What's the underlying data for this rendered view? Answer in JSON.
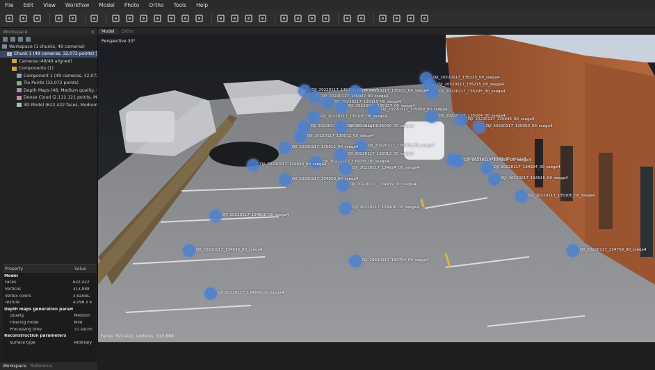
{
  "menu": [
    "File",
    "Edit",
    "View",
    "Workflow",
    "Model",
    "Photo",
    "Ortho",
    "Tools",
    "Help"
  ],
  "toolbar_icons": [
    "new-icon",
    "open-icon",
    "save-icon",
    "undo-icon",
    "redo-icon",
    "delete-icon",
    "select-icon",
    "rectangle-selection-icon",
    "resize-region-icon",
    "rotate-region-icon",
    "ruler-icon",
    "cut-icon",
    "crop-icon",
    "zoom-in-icon",
    "zoom-out-icon",
    "move-object-icon",
    "navigation-icon",
    "point-cloud-icon",
    "dense-cloud-icon",
    "model-icon",
    "tiled-model-icon",
    "shaded-icon",
    "textured-icon",
    "cameras-icon",
    "markers-icon",
    "images-icon",
    "reset-view-icon"
  ],
  "workspace": {
    "title": "Workspace",
    "tree": [
      {
        "label": "Workspace (1 chunks, 49 cameras)",
        "level": 0,
        "icon": "workspace-icon"
      },
      {
        "label": "Chunk 1 (49 cameras, 32,072 points) [T]",
        "level": 1,
        "icon": "chunk-icon",
        "selected": true
      },
      {
        "label": "Cameras (48/49 aligned)",
        "level": 2,
        "icon": "folder-icon"
      },
      {
        "label": "Components (1)",
        "level": 2,
        "icon": "folder-icon"
      },
      {
        "label": "Component 1 (49 cameras, 32,072 points",
        "level": 3,
        "icon": "component-icon"
      },
      {
        "label": "Tie Points (32,072 points)",
        "level": 3,
        "icon": "tie-points-icon"
      },
      {
        "label": "Depth Maps (48, Medium quality, Mild",
        "level": 3,
        "icon": "depth-maps-icon"
      },
      {
        "label": "Dense Cloud (2,112,121 points, Medium",
        "level": 3,
        "icon": "dense-cloud-icon"
      },
      {
        "label": "3D Model (622,422 faces, Medium qual",
        "level": 3,
        "icon": "model-icon"
      }
    ]
  },
  "properties": {
    "col_property": "Property",
    "col_value": "Value",
    "rows": [
      {
        "name": "Model",
        "value": "",
        "type": "section"
      },
      {
        "name": "Faces",
        "value": "622,422",
        "type": "row"
      },
      {
        "name": "Vertices",
        "value": "313,888",
        "type": "row"
      },
      {
        "name": "Vertex colors",
        "value": "3 bands,",
        "type": "row"
      },
      {
        "name": "Texture",
        "value": "4,096 x 4",
        "type": "row"
      },
      {
        "name": "Depth maps generation parameters",
        "value": "",
        "type": "section"
      },
      {
        "name": "Quality",
        "value": "Medium",
        "type": "indent"
      },
      {
        "name": "Filtering mode",
        "value": "Mild",
        "type": "indent"
      },
      {
        "name": "Processing time",
        "value": "31 secon",
        "type": "indent"
      },
      {
        "name": "Reconstruction parameters",
        "value": "",
        "type": "section"
      },
      {
        "name": "Surface type",
        "value": "Arbitrary",
        "type": "indent"
      }
    ]
  },
  "bottom_tabs": {
    "active": "Workspace",
    "inactive": "Reference"
  },
  "view_tabs": {
    "active": "Model",
    "inactive": "Ortho"
  },
  "viewport": {
    "projection": "Perspective 30°",
    "status": "Faces: 622,422, vertices: 313,888"
  },
  "cameras": [
    {
      "label": "DJI_20220117_135225_00_ssega4"
    },
    {
      "label": "DJI_20220117_135215_00_ssega4"
    },
    {
      "label": "DJI_20220117_135205_00_ssega4"
    },
    {
      "label": "DJI_20220117_135152_00_ssega4"
    },
    {
      "label": "DJI_20220117_135031_00_ssega4"
    },
    {
      "label": "DJI_20220117_135022_00_ssega4"
    },
    {
      "label": "DJI_20220117_135115_00_ssega4"
    },
    {
      "label": "DJI_20220117_135127_00_ssega4"
    },
    {
      "label": "DJI_20220117_135059_00_ssega4"
    },
    {
      "label": "DJI_20220117_135100_00_ssega4"
    },
    {
      "label": "DJI_20220117_135024_00_ssega4"
    },
    {
      "label": "DJI_20220117_135045_00_ssega4"
    },
    {
      "label": "DJI_20220117_135050_00_ssega4"
    },
    {
      "label": "DJI_20220117_135038_00_ssega4"
    },
    {
      "label": "DJI_20220117_135040_00_ssega4"
    },
    {
      "label": "DJI_20220117_135032_00_ssega4"
    },
    {
      "label": "DJI_20220117_135018_00_ssega4"
    },
    {
      "label": "DJI_20220117_135011_00_ssega4"
    },
    {
      "label": "DJI_20220117_135005_00_ssega4"
    },
    {
      "label": "DJI_20220117_135012_00_ssega4"
    },
    {
      "label": "DJI_20220117_135001_00_ssega4"
    },
    {
      "label": "DJI_20220117_134949_00_ssega4"
    },
    {
      "label": "DJI_20220117_134956_00_ssega4"
    },
    {
      "label": "DJI_20220117_134924_00_ssega4"
    },
    {
      "label": "DJI_20220117_134939_00_ssega4"
    },
    {
      "label": "DJI_20220117_134930_00_ssega4"
    },
    {
      "label": "DJI_20220117_134924_00_ssega4"
    },
    {
      "label": "DJI_20220117_134915_00_ssega4"
    },
    {
      "label": "DJI_20220117_134906_00_ssega4"
    },
    {
      "label": "DJI_20220117_135100_00_ssega4"
    },
    {
      "label": "DJI_20220117_134858_00_ssega4"
    },
    {
      "label": "DJI_20220117_134836_00_ssega4"
    },
    {
      "label": "DJI_20220117_134754_00_ssega4"
    },
    {
      "label": "DJI_20220117_134759_00_ssega4"
    },
    {
      "label": "DJI_20220117_134909_00_ssega4"
    }
  ],
  "colors": {
    "camera": "#4e80cd",
    "selection": "#3a4a66",
    "background": "#1e1e1e"
  }
}
